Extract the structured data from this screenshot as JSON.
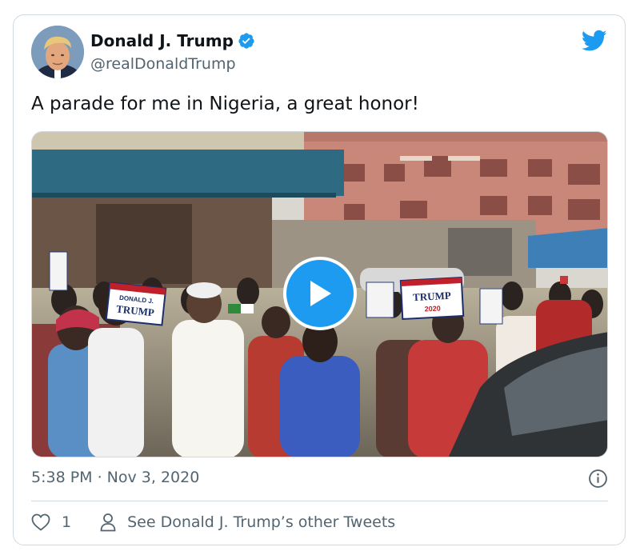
{
  "tweet": {
    "author_name": "Donald J. Trump",
    "author_handle": "@realDonaldTrump",
    "text": "A parade for me in Nigeria, a great honor!",
    "timestamp": "5:38 PM · Nov 3, 2020",
    "like_count": "1",
    "see_other_label": "See Donald J. Trump’s other Tweets",
    "verified": true
  },
  "media": {
    "type": "video",
    "sign_left_line1": "DONALD J.",
    "sign_left_line2": "TRUMP",
    "sign_center": "TRUMP",
    "sign_center_year": "2020"
  },
  "icons": {
    "verified": "verified-badge-icon",
    "brand": "twitter-bird-icon",
    "play": "play-icon",
    "info": "info-icon",
    "like": "heart-icon",
    "profile": "person-icon"
  },
  "colors": {
    "accent": "#1d9bf0",
    "secondary_text": "#536471",
    "border": "#cfd9de"
  }
}
